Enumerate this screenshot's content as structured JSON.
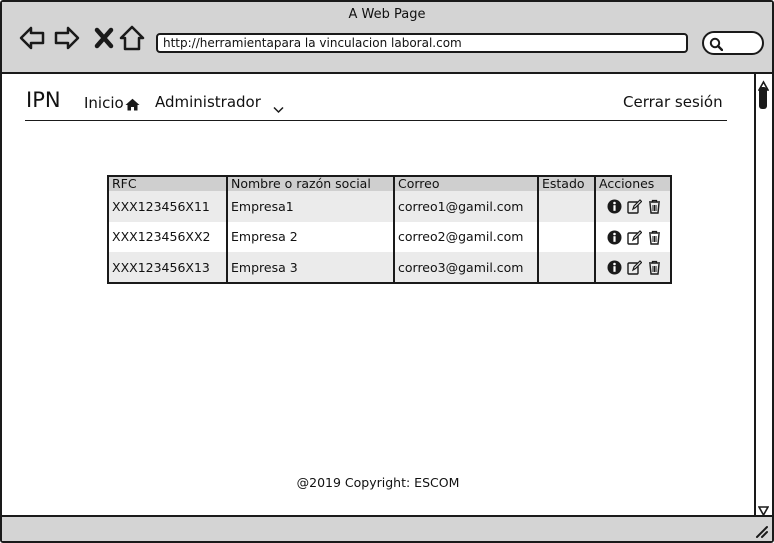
{
  "window": {
    "title": "A Web Page",
    "url": "http://herramientapara la vinculacion laboral.com"
  },
  "header": {
    "brand": "IPN",
    "nav_home": "Inicio",
    "nav_admin": "Administrador",
    "logout": "Cerrar sesión"
  },
  "table": {
    "columns": [
      "RFC",
      "Nombre o razón social",
      "Correo",
      "Estado",
      "Acciones"
    ],
    "rows": [
      {
        "rfc": "XXX123456X11",
        "nombre": "Empresa1",
        "correo": "correo1@gamil.com",
        "estado": ""
      },
      {
        "rfc": "XXX123456XX2",
        "nombre": "Empresa 2",
        "correo": "correo2@gamil.com",
        "estado": ""
      },
      {
        "rfc": "XXX123456X13",
        "nombre": "Empresa 3",
        "correo": "correo3@gamil.com",
        "estado": ""
      }
    ],
    "header_bg": "#cfcfcf",
    "row_alt_bg": "#ebebeb"
  },
  "footer": {
    "copyright": "@2019 Copyright: ESCOM"
  },
  "icons": {
    "back": "arrow-left-icon",
    "forward": "arrow-right-icon",
    "stop": "close-icon",
    "home": "home-icon",
    "search": "search-icon",
    "info": "info-icon",
    "edit": "edit-icon",
    "delete": "trash-icon"
  }
}
